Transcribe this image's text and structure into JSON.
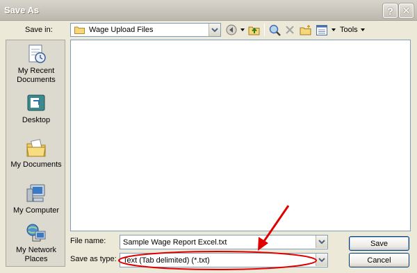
{
  "window": {
    "title": "Save As",
    "help_button": "?",
    "close_button": "✕"
  },
  "save_in": {
    "label": "Save in:",
    "value": "Wage Upload Files"
  },
  "toolbar": {
    "tools_label": "Tools"
  },
  "places": [
    {
      "icon": "recent-documents-icon",
      "label": "My Recent Documents"
    },
    {
      "icon": "desktop-icon",
      "label": "Desktop"
    },
    {
      "icon": "my-documents-icon",
      "label": "My Documents"
    },
    {
      "icon": "my-computer-icon",
      "label": "My Computer"
    },
    {
      "icon": "network-places-icon",
      "label": "My Network Places"
    }
  ],
  "file_name": {
    "label": "File name:",
    "value": "Sample Wage Report Excel.txt"
  },
  "save_as_type": {
    "label": "Save as type:",
    "value": "Text (Tab delimited) (*.txt)"
  },
  "buttons": {
    "save": "Save",
    "cancel": "Cancel"
  },
  "annotation": {
    "color": "#e00000"
  }
}
